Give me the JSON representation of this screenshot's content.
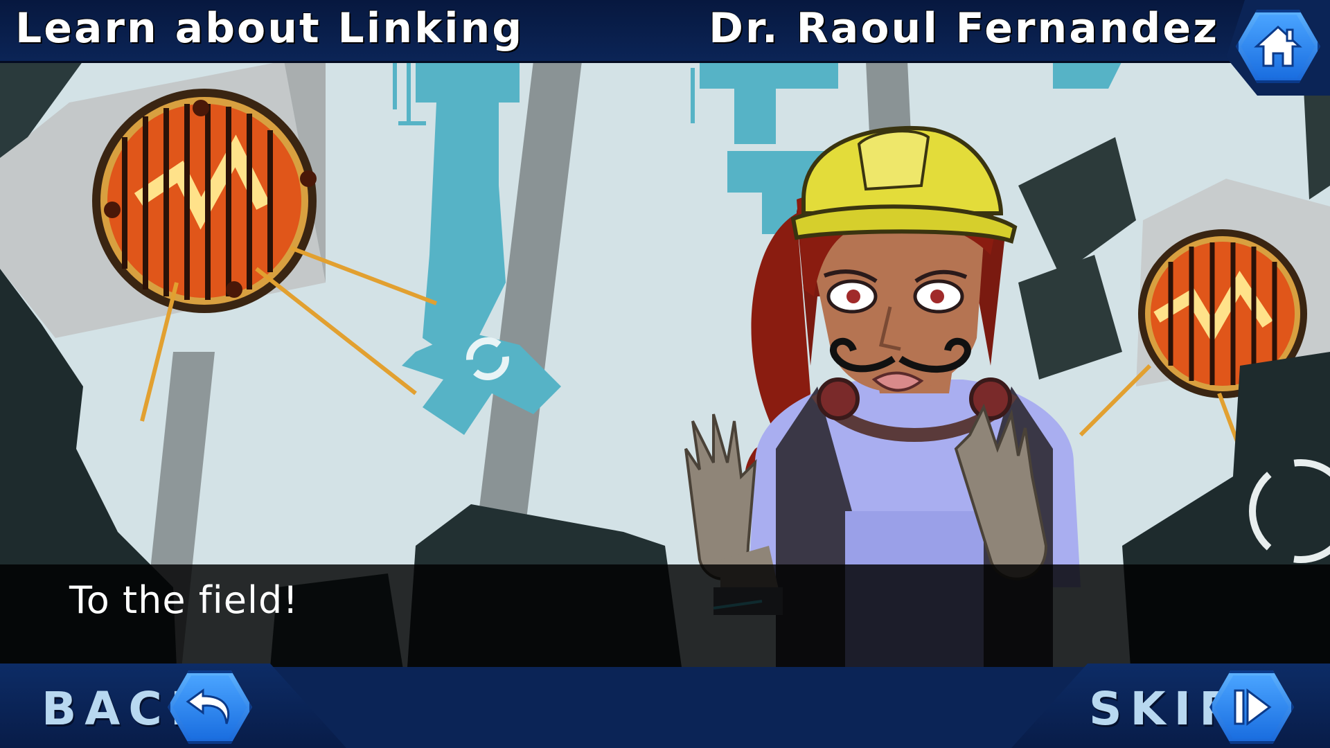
{
  "header": {
    "title": "Learn about Linking",
    "speaker": "Dr. Raoul Fernandez"
  },
  "dialogue": {
    "text": "To the field!"
  },
  "controls": {
    "back_label": "BACK",
    "skip_label": "SKIP",
    "home_icon": "home-icon",
    "back_icon": "undo-arrow-icon",
    "skip_icon": "skip-forward-icon"
  },
  "colors": {
    "accent": "#2f86ef",
    "bar": "#0b2456",
    "label": "#b8d8f0"
  }
}
